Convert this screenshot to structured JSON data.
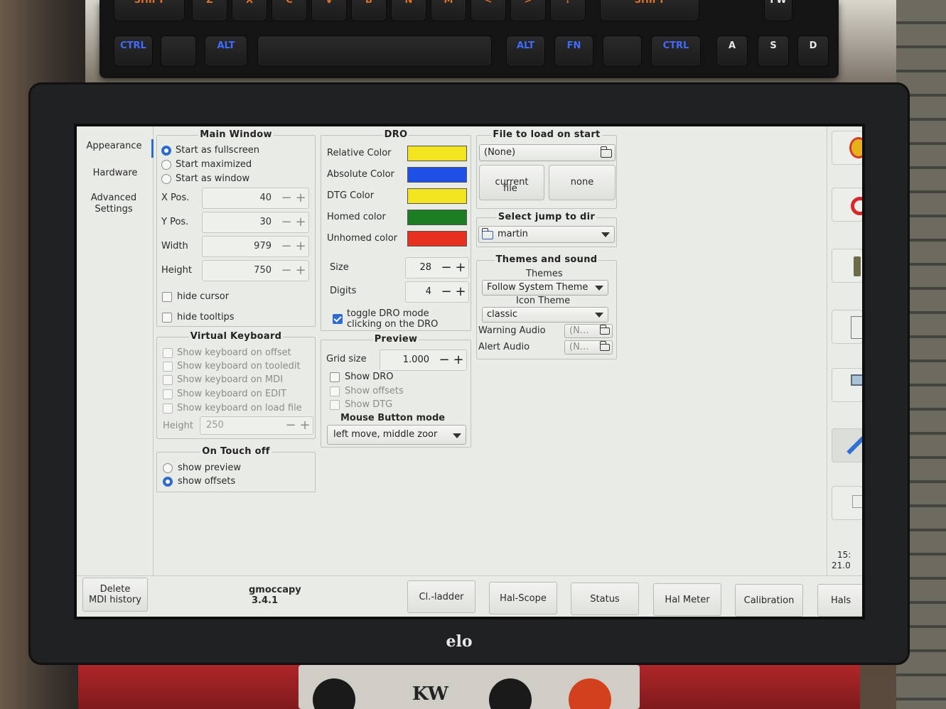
{
  "sidebar": {
    "tabs": [
      {
        "label": "Appearance"
      },
      {
        "label": "Hardware"
      },
      {
        "label": "Advanced Settings"
      }
    ]
  },
  "main_window": {
    "title": "Main Window",
    "options": [
      "Start as fullscreen",
      "Start maximized",
      "Start as window"
    ],
    "selected": "Start as fullscreen",
    "fields": [
      {
        "label": "X Pos.",
        "value": "40"
      },
      {
        "label": "Y Pos.",
        "value": "30"
      },
      {
        "label": "Width",
        "value": "979"
      },
      {
        "label": "Height",
        "value": "750"
      }
    ],
    "hide_cursor": "hide cursor",
    "hide_tooltips": "hide tooltips"
  },
  "virtual_keyboard": {
    "title": "Virtual Keyboard",
    "options": [
      "Show keyboard on offset",
      "Show keyboard on tooledit",
      "Show keyboard on MDI",
      "Show keyboard on EDIT",
      "Show keyboard on load file"
    ],
    "height_label": "Height",
    "height_value": "250"
  },
  "touch_off": {
    "title": "On Touch off",
    "options": [
      "show preview",
      "show offsets"
    ],
    "selected": "show offsets"
  },
  "dro": {
    "title": "DRO",
    "colors": [
      {
        "label": "Relative Color",
        "color": "#f2e41f"
      },
      {
        "label": "Absolute Color",
        "color": "#1e4fe6"
      },
      {
        "label": "DTG Color",
        "color": "#f2e41f"
      },
      {
        "label": "Homed color",
        "color": "#1d7d22"
      },
      {
        "label": "Unhomed color",
        "color": "#e63120"
      }
    ],
    "size_label": "Size",
    "size_value": "28",
    "digits_label": "Digits",
    "digits_value": "4",
    "toggle_label_1": "toggle DRO mode",
    "toggle_label_2": "clicking on the DRO"
  },
  "preview": {
    "title": "Preview",
    "grid_label": "Grid size",
    "grid_value": "1.000",
    "options": [
      "Show DRO",
      "Show offsets",
      "Show DTG"
    ],
    "mouse_title": "Mouse Button mode",
    "mouse_value": "left move,  middle zoor"
  },
  "file_load": {
    "title": "File to load on start",
    "value": "(None)",
    "btn_current_1": "current",
    "btn_current_2": "file",
    "btn_none": "none"
  },
  "jump_dir": {
    "title": "Select jump to dir",
    "value": "martin"
  },
  "themes": {
    "title": "Themes and sound",
    "themes_label": "Themes",
    "themes_value": "Follow System Theme",
    "icon_label": "Icon Theme",
    "icon_value": "classic",
    "warning_label": "Warning Audio",
    "warning_value": "(N…",
    "alert_label": "Alert Audio",
    "alert_value": "(N…"
  },
  "clock": {
    "line1": "15:",
    "line2": "21.0"
  },
  "bottom_bar": {
    "delete_1": "Delete",
    "delete_2": "MDI history",
    "app_name": "gmoccapy",
    "app_version": "3.4.1",
    "buttons": [
      "Cl.-ladder",
      "Hal-Scope",
      "Status",
      "Hal Meter",
      "Calibration",
      "Hals"
    ]
  },
  "keyboard": {
    "top_row": [
      "SHIFT",
      "Z",
      "X",
      "C",
      "V",
      "B",
      "N",
      "M",
      "<",
      ">",
      "?",
      "SHIFT",
      "FW"
    ],
    "bottom_row": [
      "CTRL",
      "",
      "ALT",
      "",
      "ALT",
      "FN",
      "",
      "CTRL",
      "A",
      "S",
      "D"
    ]
  },
  "monitor_brand": "elo",
  "under_brand": "KW"
}
